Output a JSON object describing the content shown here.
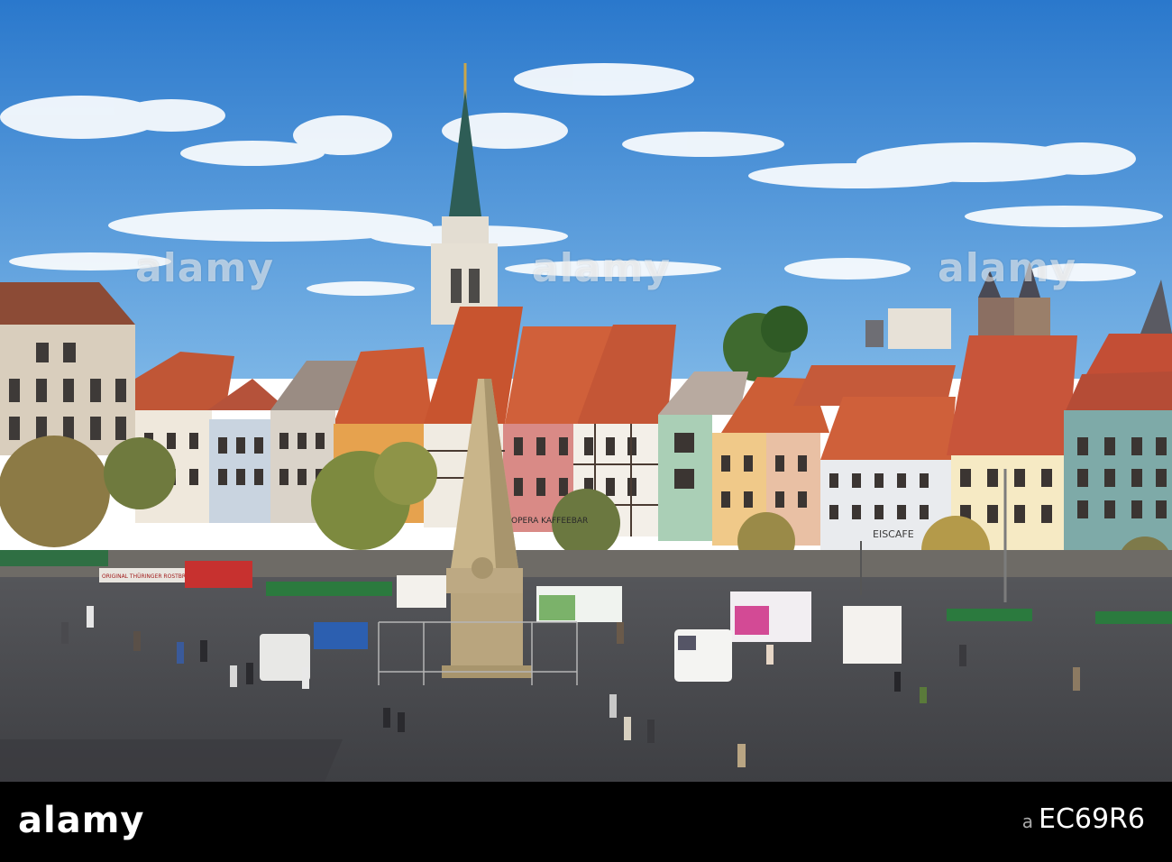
{
  "photo": {
    "watermark": "alamy",
    "shop_signs": [
      "ORIGINAL THÜRINGER ROSTBRATWURST",
      "OPERA KAFFEEBAR",
      "EISCAFE"
    ]
  },
  "footer": {
    "logo": "alamy",
    "image_id_label": "a",
    "image_id": "EC69R6"
  },
  "colors": {
    "sky": "#2f86d6",
    "roof": "#c85a36",
    "pavement": "#4b4c50",
    "footer": "#000000"
  }
}
